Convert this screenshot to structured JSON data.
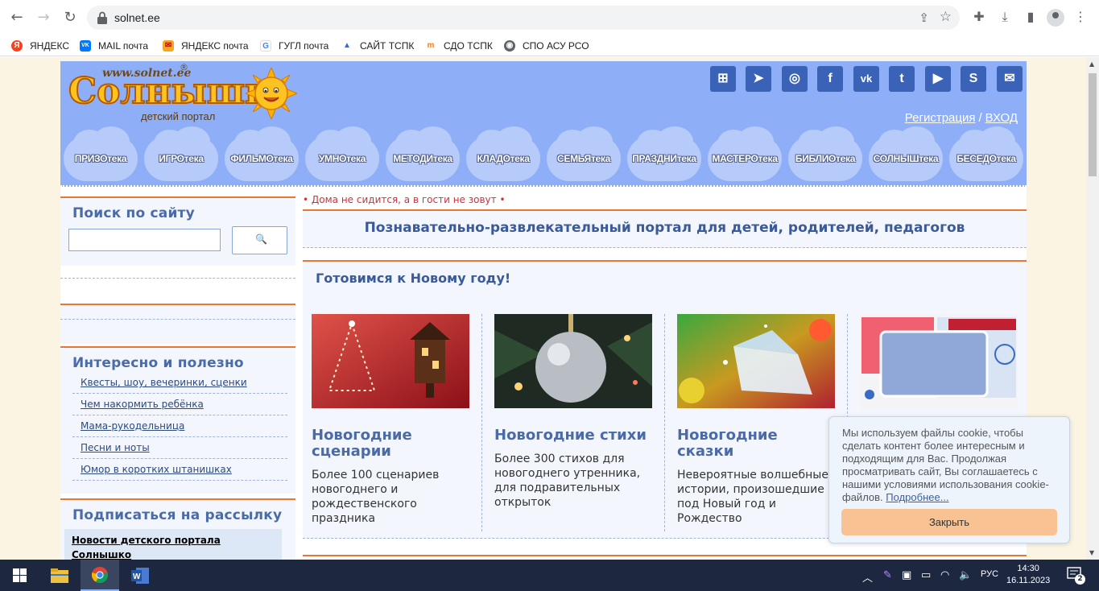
{
  "browser": {
    "url": "solnet.ee",
    "bookmarks": [
      {
        "label": "ЯНДЕКС",
        "icon": "yandex-icon",
        "color": "#fc3f1d",
        "glyph": "Я"
      },
      {
        "label": "MAIL почта",
        "icon": "vk-icon",
        "color": "#0077ff",
        "glyph": "VK"
      },
      {
        "label": "ЯНДЕКС почта",
        "icon": "envelope-icon",
        "color": "#f5a623",
        "glyph": "✉"
      },
      {
        "label": "ГУГЛ почта",
        "icon": "google-icon",
        "color": "#ffffff",
        "glyph": "G"
      },
      {
        "label": "САЙТ ТСПК",
        "icon": "site-icon",
        "color": "#3a6bc4",
        "glyph": "▲"
      },
      {
        "label": "СДО ТСПК",
        "icon": "moodle-icon",
        "color": "#f98012",
        "glyph": "m"
      },
      {
        "label": "СПО АСУ РСО",
        "icon": "globe-icon",
        "color": "#5f6368",
        "glyph": "◉"
      }
    ]
  },
  "site": {
    "logo_url": "www.solnet.ee",
    "logo_reg": "®",
    "logo_text": "Солнышк",
    "logo_sub": "детский портал",
    "social_icons": [
      "sitemap-icon",
      "telegram-icon",
      "instagram-icon",
      "facebook-icon",
      "vk-icon",
      "twitter-icon",
      "youtube-icon",
      "skype-icon",
      "mail-icon"
    ],
    "social_glyphs": [
      "⊞",
      "➤",
      "◎",
      "f",
      "vk",
      "t",
      "▶",
      "S",
      "✉"
    ],
    "register_label": "Регистрация",
    "auth_separator": "/",
    "login_label": "ВХОД",
    "menu": [
      "ПРИЗОтека",
      "ИГРОтека",
      "ФИЛЬМОтека",
      "УМНОтека",
      "МЕТОДИтека",
      "КЛАДОтека",
      "СЕМЬЯтека",
      "ПРАЗДНИтека",
      "МАСТЕРОтека",
      "БИБЛИОтека",
      "СОЛНЫШтека",
      "БЕСЕДОтека"
    ]
  },
  "sidebar": {
    "search_title": "Поиск по сайту",
    "search_button_icon": "🔍",
    "interesting_title": "Интересно и полезно",
    "links": [
      "Квесты, шоу, вечеринки, сценки",
      "Чем накормить ребёнка",
      "Мама-рукодельница",
      "Песни и ноты",
      "Юмор в коротких штанишках"
    ],
    "subscribe_title": "Подписаться на рассылку",
    "newsletter_label": "Новости детского портала Солнышко"
  },
  "main": {
    "slogan": "• Дома не сидится, а в гости не зовут •",
    "heading": "Познавательно-развлекательный портал для детей, родителей, педагогов",
    "section_title": "Готовимся к Новому году!",
    "cards": [
      {
        "title": "Новогодние сценарии",
        "text": "Более 100 сценариев новогоднего и рождественского праздника"
      },
      {
        "title": "Новогодние стихи",
        "text": "Более 300 стихов для новогоднего утренника, для подравительных открыток"
      },
      {
        "title": "Новогодние сказки",
        "text": "Невероятные волшебные истории, произошедшие под Новый год и Рождество"
      },
      {
        "title": "",
        "text": ""
      }
    ]
  },
  "cookie": {
    "text": "Мы используем файлы cookie, чтобы сделать контент более интересным и подходящим для Вас. Продолжая просматривать сайт, Вы соглашаетесь с нашими условиями использования cookie-файлов.",
    "more_label": "Подробнее...",
    "close_label": "Закрыть"
  },
  "taskbar": {
    "lang": "РУС",
    "time": "14:30",
    "date": "16.11.2023",
    "notifications": "2"
  }
}
